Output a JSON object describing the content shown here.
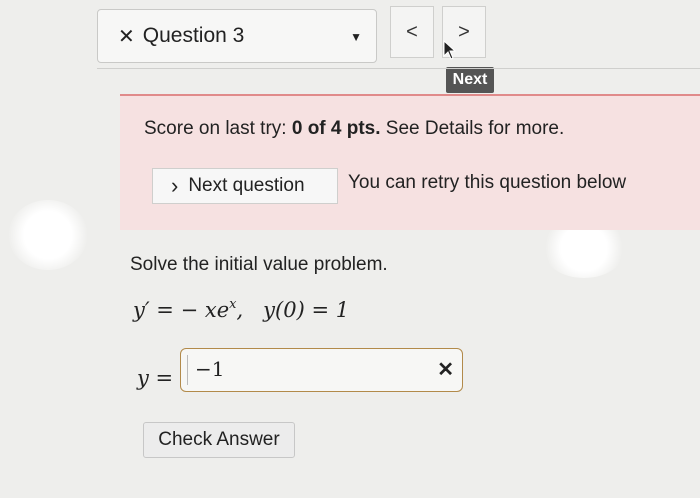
{
  "question_selector": {
    "close_glyph": "✕",
    "label": "Question 3",
    "caret": "▼"
  },
  "nav": {
    "prev": "<",
    "next": ">",
    "tooltip": "Next"
  },
  "score": {
    "prefix": "Score on last try: ",
    "score": "0 of 4 pts.",
    "suffix": " See Details for more.",
    "next_question_chevron": "›",
    "next_question_label": "Next question",
    "retry_text": "You can retry this question below"
  },
  "problem": {
    "prompt": "Solve the initial value problem.",
    "eq_lhs": "y′ = − x",
    "eq_e": "e",
    "eq_exp": "x",
    "eq_ic": ",   y(0) = 1",
    "answer_label": "y =",
    "answer_value": "−1",
    "answer_status": "✕"
  },
  "check_answer": "Check Answer"
}
